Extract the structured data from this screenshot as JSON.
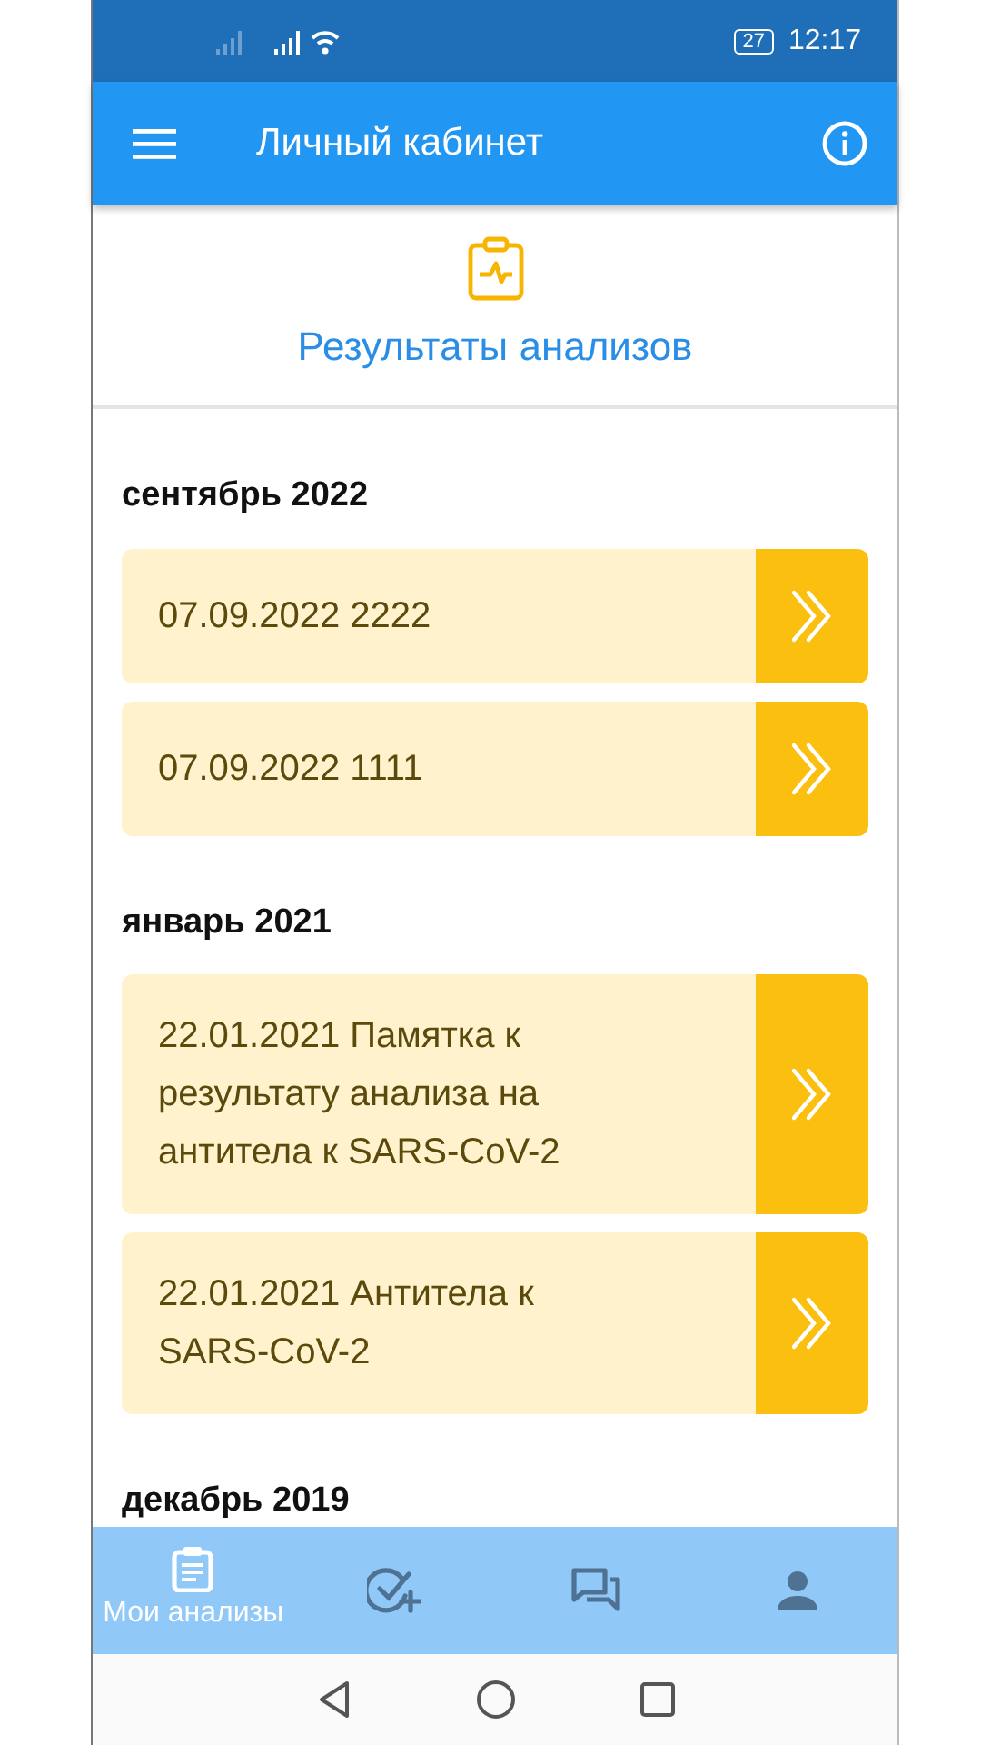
{
  "status_bar": {
    "battery": "27",
    "time": "12:17"
  },
  "app_bar": {
    "title": "Личный кабинет"
  },
  "header": {
    "title": "Результаты анализов"
  },
  "groups": [
    {
      "month": "сентябрь 2022",
      "items": [
        {
          "text": "07.09.2022 2222"
        },
        {
          "text": "07.09.2022 1111"
        }
      ]
    },
    {
      "month": "январь 2021",
      "items": [
        {
          "text": "22.01.2021 Памятка к результату анализа на антитела к SARS-CoV-2"
        },
        {
          "text": "22.01.2021 Антитела к SARS-CoV-2"
        }
      ]
    },
    {
      "month": "декабрь 2019"
    }
  ],
  "bottom_nav": [
    {
      "kind": "analyses",
      "label": "Мои анализы",
      "selected": true
    },
    {
      "kind": "booking",
      "selected": false
    },
    {
      "kind": "chat",
      "selected": false
    },
    {
      "kind": "profile",
      "selected": false
    }
  ]
}
